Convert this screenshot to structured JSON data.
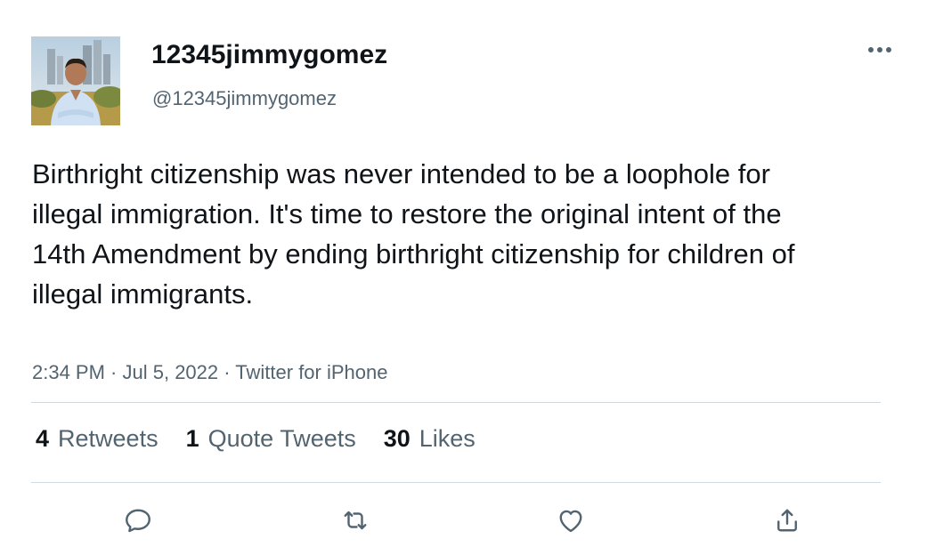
{
  "author": {
    "display_name": "12345jimmygomez",
    "handle": "@12345jimmygomez",
    "avatar_icon": "profile-photo"
  },
  "more_icon": "more-horizontal-icon",
  "tweet": {
    "text": "Birthright citizenship was never intended to be a loophole for illegal immigration. It's time to restore the original intent of the 14th Amendment by ending birthright citizenship for children of illegal immigrants."
  },
  "meta": {
    "time": "2:34 PM",
    "sep1": " · ",
    "date": "Jul 5, 2022",
    "sep2": " · ",
    "source": "Twitter for iPhone"
  },
  "stats": {
    "retweets_count": "4",
    "retweets_label": "Retweets",
    "quotes_count": "1",
    "quotes_label": "Quote Tweets",
    "likes_count": "30",
    "likes_label": "Likes"
  },
  "actions": {
    "reply_icon": "reply-icon",
    "retweet_icon": "retweet-icon",
    "like_icon": "heart-icon",
    "share_icon": "share-icon"
  },
  "colors": {
    "text_primary": "#0f1419",
    "text_secondary": "#536471",
    "divider": "#cfd9de",
    "icon": "#536471"
  }
}
